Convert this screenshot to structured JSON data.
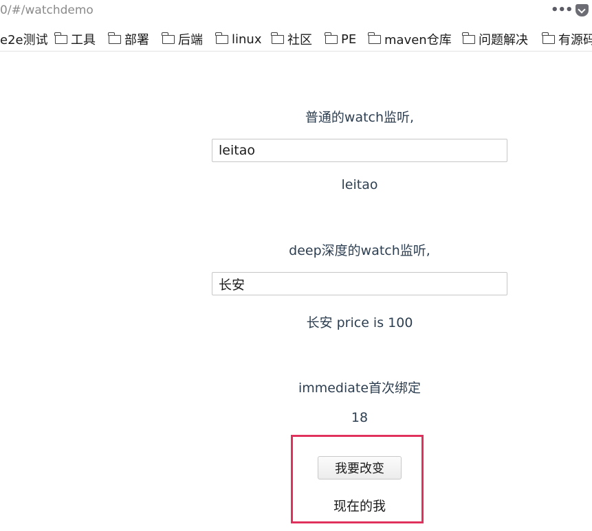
{
  "browser": {
    "url": "0/#/watchdemo",
    "bookmarks": [
      {
        "label": "e2e测试",
        "folder": false
      },
      {
        "label": "工具",
        "folder": true
      },
      {
        "label": "部署",
        "folder": true
      },
      {
        "label": "后端",
        "folder": true
      },
      {
        "label": "linux",
        "folder": true
      },
      {
        "label": "社区",
        "folder": true
      },
      {
        "label": "PE",
        "folder": true
      },
      {
        "label": "maven仓库",
        "folder": true
      },
      {
        "label": "问题解决",
        "folder": true
      },
      {
        "label": "有源码",
        "folder": true
      }
    ]
  },
  "normal_watch": {
    "heading": "普通的watch监听,",
    "input_value": "leitao",
    "output": "leitao"
  },
  "deep_watch": {
    "heading": "deep深度的watch监听,",
    "input_value": "长安",
    "output": "长安 price is 100"
  },
  "immediate_watch": {
    "heading": "immediate首次绑定",
    "value": "18",
    "button_label": "我要改变",
    "status_text": "现在的我"
  },
  "colors": {
    "text": "#2c3e50",
    "highlight_border": "#e0305c"
  }
}
